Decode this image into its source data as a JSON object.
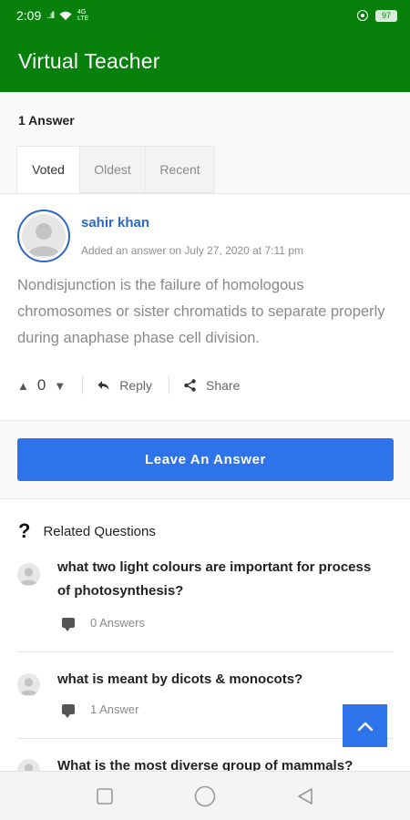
{
  "status_bar": {
    "time": "2:09",
    "signal": "..ıll",
    "network": "4G",
    "network_sub": "LTE",
    "battery": "97"
  },
  "app": {
    "title": "Virtual Teacher",
    "theme_color": "#08800c",
    "accent_color": "#2e73e9",
    "link_color": "#2c67c7"
  },
  "answers": {
    "count_label": "1 Answer",
    "tabs": [
      {
        "label": "Voted",
        "active": true
      },
      {
        "label": "Oldest",
        "active": false
      },
      {
        "label": "Recent",
        "active": false
      }
    ],
    "items": [
      {
        "author": "sahir khan",
        "meta": "Added an answer on July 27, 2020 at 7:11 pm",
        "text": "Nondisjunction is the failure of homologous chromosomes or sister chromatids to separate properly during anaphase phase cell division.",
        "votes": "0",
        "reply_label": "Reply",
        "share_label": "Share"
      }
    ]
  },
  "leave_answer_label": "Leave An Answer",
  "related": {
    "heading": "Related Questions",
    "heading_icon": "?",
    "items": [
      {
        "question": "what two light colours are important for process of photosynthesis?",
        "answers": "0 Answers"
      },
      {
        "question": "what is meant by dicots & monocots?",
        "answers": "1 Answer"
      },
      {
        "question": "What is the most diverse group of mammals?",
        "answers": ""
      }
    ]
  }
}
